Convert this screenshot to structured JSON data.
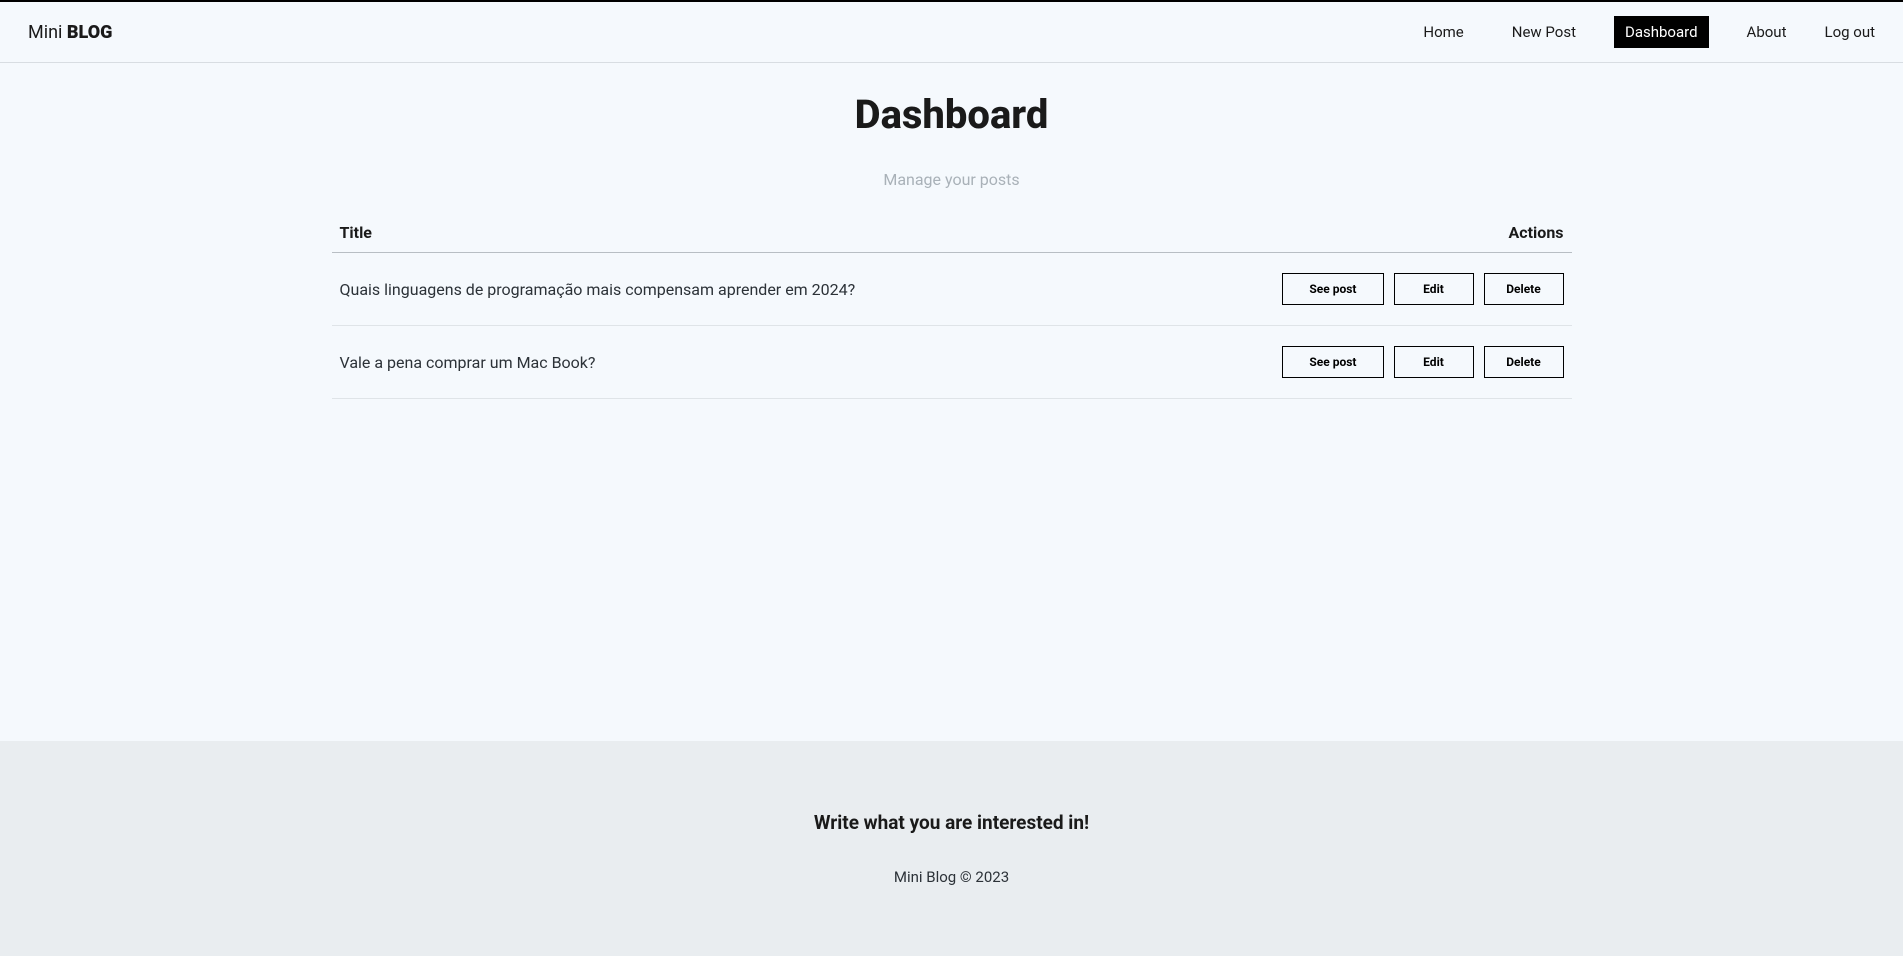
{
  "brand": {
    "light": "Mini ",
    "bold": "BLOG"
  },
  "nav": {
    "home": "Home",
    "new_post": "New Post",
    "dashboard": "Dashboard",
    "about": "About",
    "logout": "Log out"
  },
  "page": {
    "title": "Dashboard",
    "subtitle": "Manage your posts"
  },
  "table": {
    "header_title": "Title",
    "header_actions": "Actions",
    "see_label": "See post",
    "edit_label": "Edit",
    "delete_label": "Delete"
  },
  "posts": [
    {
      "title": "Quais linguagens de programação mais compensam aprender em 2024?"
    },
    {
      "title": "Vale a pena comprar um Mac Book?"
    }
  ],
  "footer": {
    "heading": "Write what you are interested in!",
    "copyright": "Mini Blog © 2023"
  }
}
